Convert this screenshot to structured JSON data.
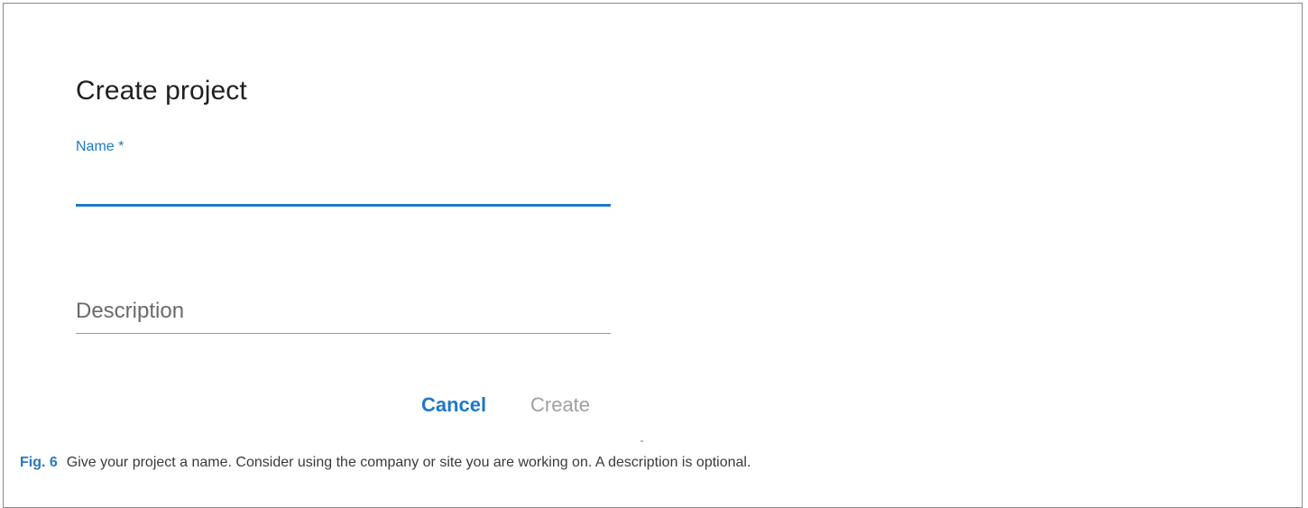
{
  "dialog": {
    "title": "Create project",
    "name_field": {
      "label": "Name *",
      "value": ""
    },
    "description_field": {
      "placeholder": "Description",
      "value": ""
    },
    "actions": {
      "cancel_label": "Cancel",
      "create_label": "Create"
    }
  },
  "caption": {
    "label": "Fig. 6",
    "text": "Give your project a name. Consider using the company or site you are working on. A description is optional."
  },
  "colors": {
    "accent": "#1e78c8",
    "disabled_text": "#a0a0a0",
    "caption_label": "#2a7ab8"
  }
}
